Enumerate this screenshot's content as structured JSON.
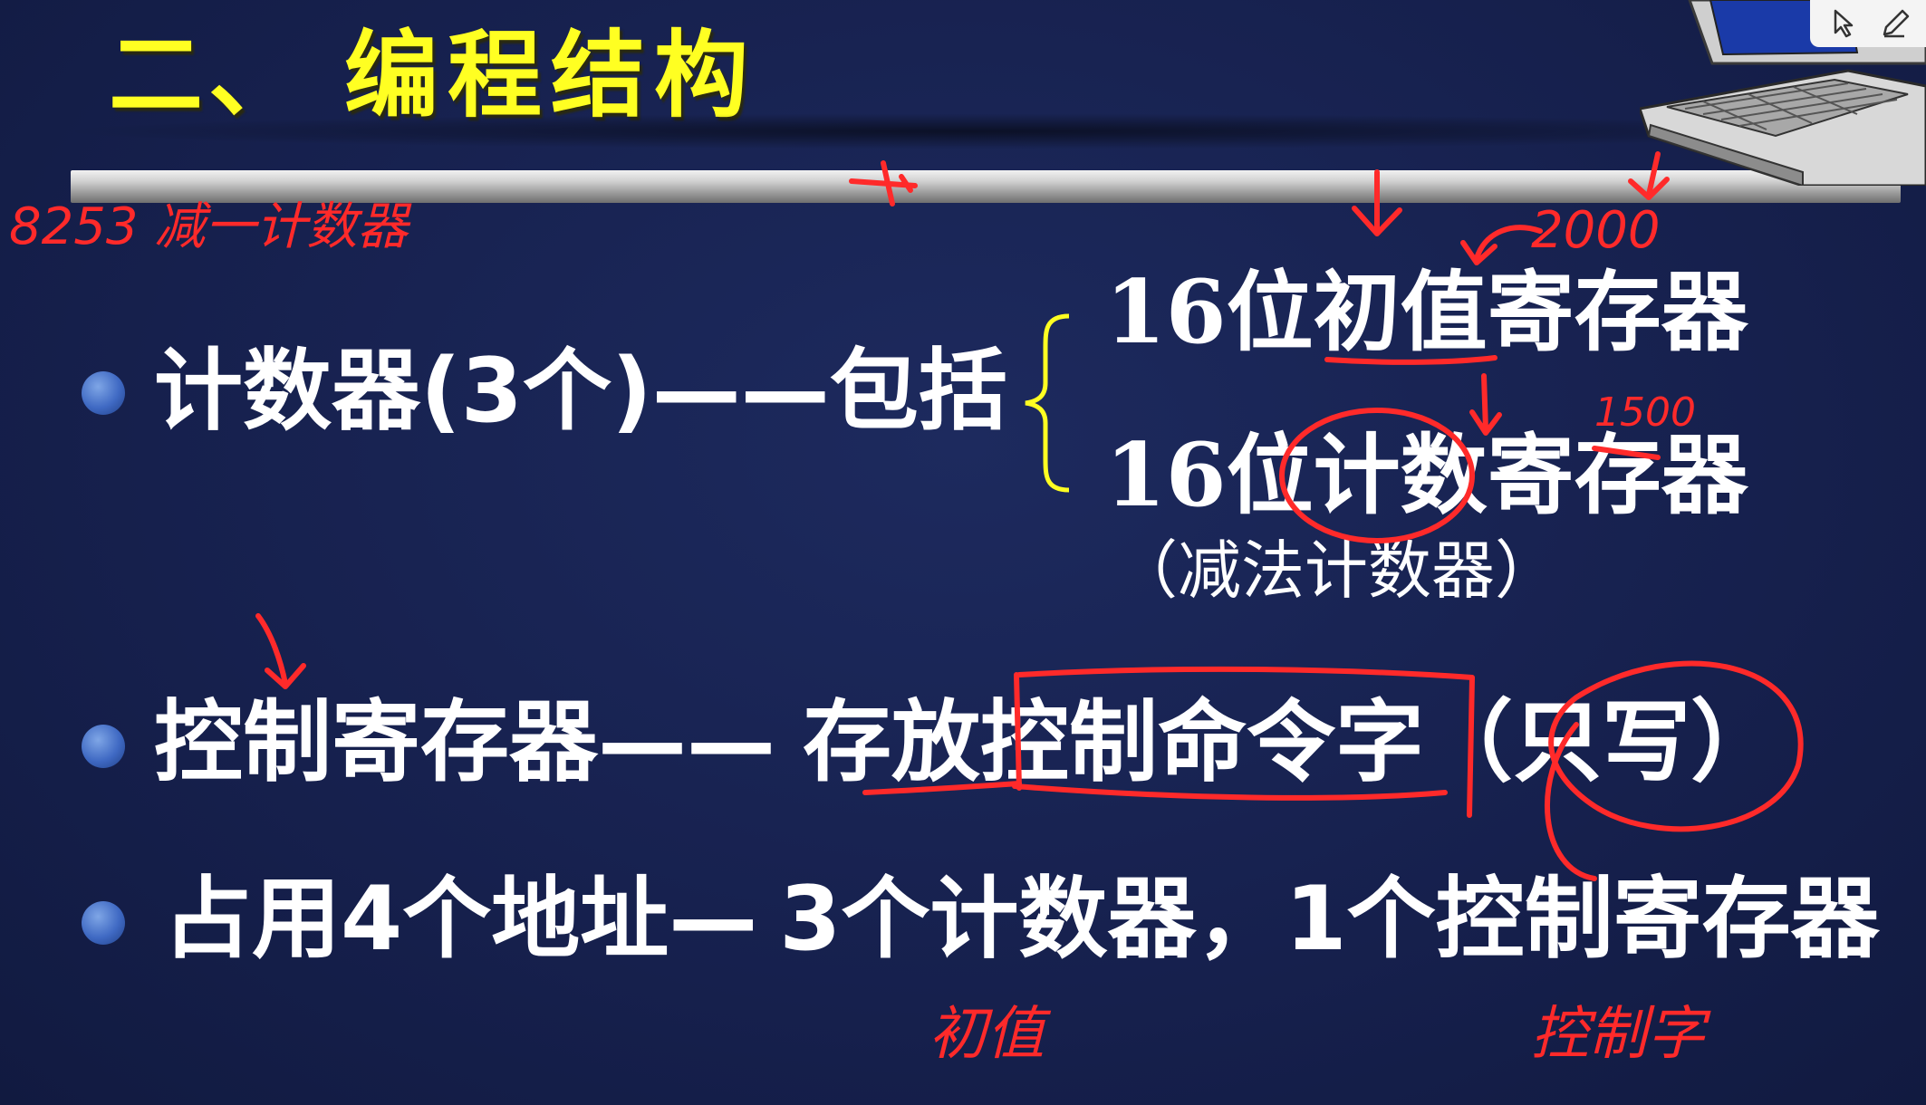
{
  "slide": {
    "title_number": "二、",
    "title_text": "编程结构",
    "counter": {
      "label": "计数器(3个)",
      "connector": "——",
      "includes": "包括",
      "registers": [
        "16位初值寄存器",
        "16位计数寄存器"
      ],
      "register_note": "（减法计数器）"
    },
    "control": {
      "label": "控制寄存器",
      "connector": "——",
      "desc_prefix": "存放",
      "desc_main": "控制命令字",
      "paren_open": "（",
      "paren_content": "只写",
      "paren_close": "）"
    },
    "address": {
      "prefix": "占用",
      "count": "4",
      "suffix1": "个地址",
      "connector": "—",
      "part2_count": "3",
      "part2": "个计数器，",
      "part3_count": "1",
      "part3": "个控制寄存器"
    }
  },
  "handwriting": {
    "top_left": "8253 减一计数器",
    "above_initial": "2000",
    "above_count": "1500",
    "below_left": "初值",
    "below_right": "控制字"
  },
  "toolbar": {
    "pointer_icon": "cursor-icon",
    "pen_icon": "pen-icon"
  },
  "colors": {
    "background": "#16204d",
    "title": "#ffff22",
    "body_text": "#ffffff",
    "annotation": "#ff2a2a",
    "brace": "#ffff22",
    "bullet": "#3f69c3"
  }
}
